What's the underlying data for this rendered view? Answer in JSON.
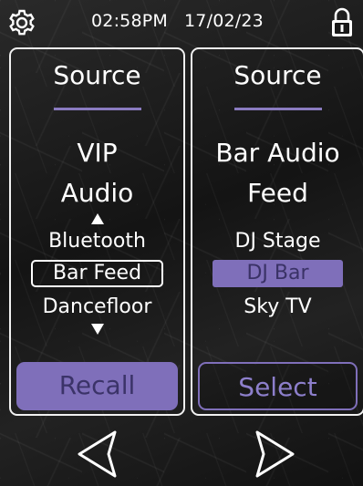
{
  "status": {
    "time": "02:58PM",
    "date": "17/02/23",
    "icons": {
      "settings": "gear-icon",
      "lock": "lock-icon"
    }
  },
  "left_panel": {
    "title": "Source",
    "selected_line1": "VIP",
    "selected_line2": "Audio",
    "options": [
      "Bluetooth",
      "Bar Feed",
      "Dancefloor"
    ],
    "boxed_option_index": 1,
    "action_label": "Recall"
  },
  "right_panel": {
    "title": "Source",
    "selected_line1": "Bar Audio",
    "selected_line2": "Feed",
    "options": [
      "DJ Stage",
      "DJ Bar",
      "Sky TV"
    ],
    "highlighted_option_index": 1,
    "action_label": "Select"
  },
  "navigation": {
    "prev_icon": "chevron-left-icon",
    "next_icon": "chevron-right-icon"
  },
  "colors": {
    "accent": "#7f6fba",
    "text": "#ffffff",
    "panel_border": "#f1f1f1",
    "background": "#181818"
  }
}
